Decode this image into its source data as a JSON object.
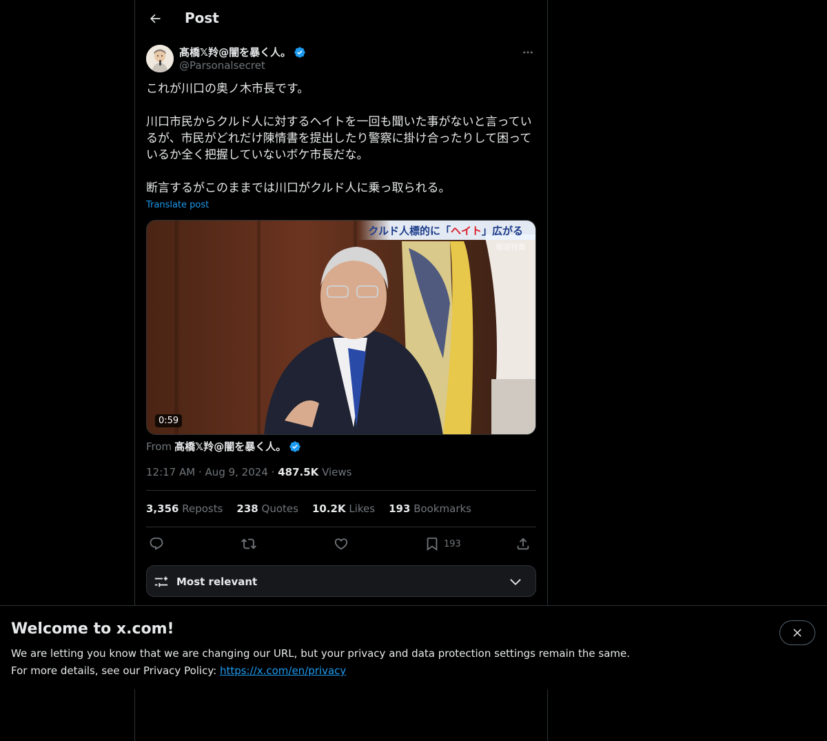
{
  "header": {
    "title": "Post",
    "back_icon": "arrow-left-icon"
  },
  "author": {
    "display_name": "髙橋𝕏羚@闇を暴く人。",
    "handle": "@Parsonalsecret",
    "verified_icon": "verified-badge-icon"
  },
  "post": {
    "text": "これが川口の奥ノ木市長です。\n\n川口市民からクルド人に対するヘイトを一回も聞いた事がないと言ってい\nるが、市民がどれだけ陳情書を提出したり警察に掛け合ったりして困って\nいるか全く把握していないボケ市長だな。\n\n断言するがこのままでは川口がクルド人に乗っ取られる。",
    "translate_label": "Translate post"
  },
  "media": {
    "duration": "0:59",
    "caption_prefix": "クルド人標的に「",
    "caption_highlight": "ヘイト",
    "caption_suffix": "」広がる",
    "caption_sub": "報道特集"
  },
  "from": {
    "prefix": "From",
    "name": "髙橋𝕏羚@闇を暴く人。"
  },
  "meta": {
    "time": "12:17 AM",
    "date": "Aug 9, 2024",
    "views_count": "487.5K",
    "views_label": "Views",
    "sep": "·"
  },
  "stats": {
    "reposts_count": "3,356",
    "reposts_label": "Reposts",
    "quotes_count": "238",
    "quotes_label": "Quotes",
    "likes_count": "10.2K",
    "likes_label": "Likes",
    "bookmarks_count": "193",
    "bookmarks_label": "Bookmarks"
  },
  "actions": {
    "bookmark_count": "193"
  },
  "sort": {
    "label": "Most relevant"
  },
  "banner": {
    "title": "Welcome to x.com!",
    "line1": "We are letting you know that we are changing our URL, but your privacy and data protection settings remain the same.",
    "line2_prefix": "For more details, see our Privacy Policy: ",
    "link": "https://x.com/en/privacy"
  },
  "colors": {
    "accent": "#1d9bf0",
    "background": "#000000",
    "text": "#e7e9ea",
    "muted": "#71767b",
    "border": "#2f3336"
  }
}
